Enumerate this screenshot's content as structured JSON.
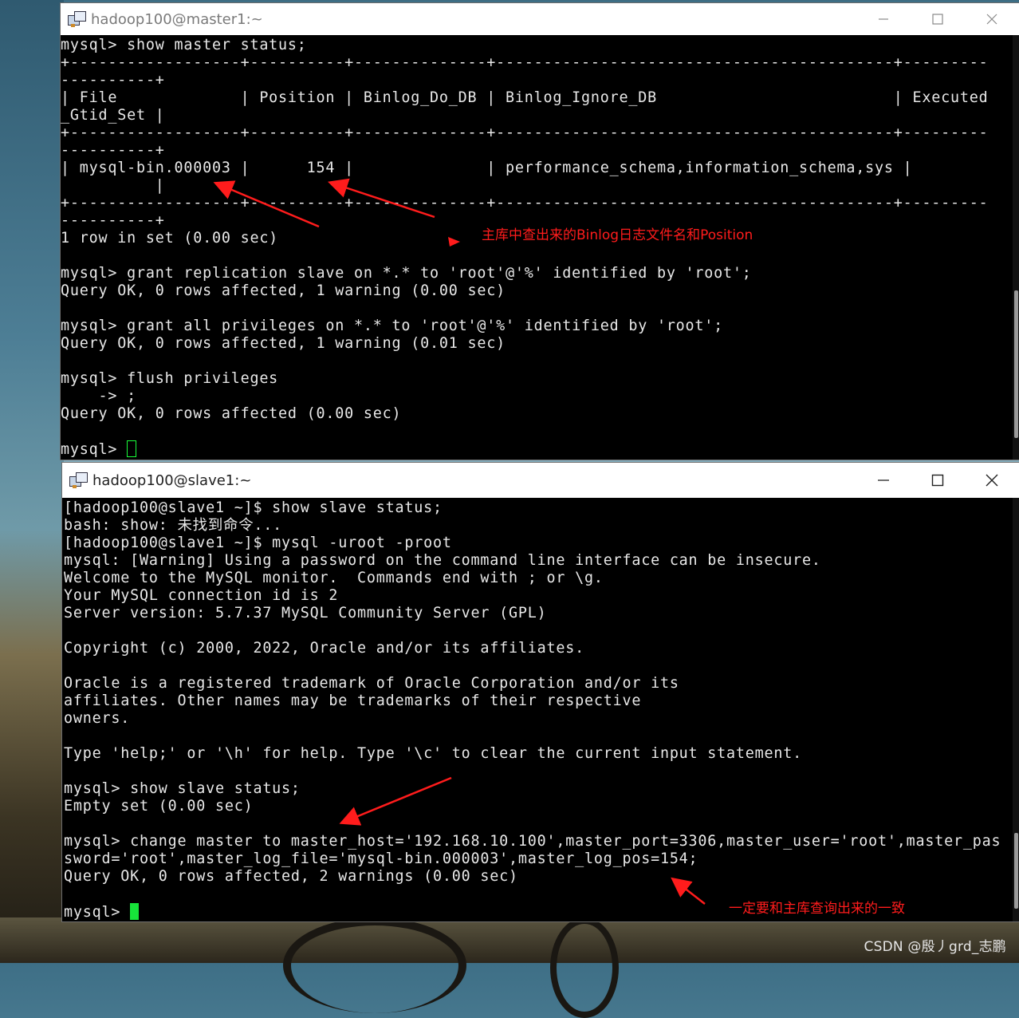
{
  "watermark": "CSDN @殷丿grd_志鹏",
  "master_window": {
    "title": "hadoop100@master1:~",
    "lines": [
      "mysql> show master status;",
      "+------------------+----------+--------------+------------------------------------------+---------",
      "----------+",
      "| File             | Position | Binlog_Do_DB | Binlog_Ignore_DB                         | Executed",
      "_Gtid_Set |",
      "+------------------+----------+--------------+------------------------------------------+---------",
      "----------+",
      "| mysql-bin.000003 |      154 |              | performance_schema,information_schema,sys |",
      "          |",
      "+------------------+----------+--------------+------------------------------------------+---------",
      "----------+",
      "1 row in set (0.00 sec)",
      "",
      "mysql> grant replication slave on *.* to 'root'@'%' identified by 'root';",
      "Query OK, 0 rows affected, 1 warning (0.00 sec)",
      "",
      "mysql> grant all privileges on *.* to 'root'@'%' identified by 'root';",
      "Query OK, 0 rows affected, 1 warning (0.01 sec)",
      "",
      "mysql> flush privileges",
      "    -> ;",
      "Query OK, 0 rows affected (0.00 sec)",
      "",
      "mysql> "
    ]
  },
  "slave_window": {
    "title": "hadoop100@slave1:~",
    "lines": [
      "[hadoop100@slave1 ~]$ show slave status;",
      "bash: show: 未找到命令...",
      "[hadoop100@slave1 ~]$ mysql -uroot -proot",
      "mysql: [Warning] Using a password on the command line interface can be insecure.",
      "Welcome to the MySQL monitor.  Commands end with ; or \\g.",
      "Your MySQL connection id is 2",
      "Server version: 5.7.37 MySQL Community Server (GPL)",
      "",
      "Copyright (c) 2000, 2022, Oracle and/or its affiliates.",
      "",
      "Oracle is a registered trademark of Oracle Corporation and/or its",
      "affiliates. Other names may be trademarks of their respective",
      "owners.",
      "",
      "Type 'help;' or '\\h' for help. Type '\\c' to clear the current input statement.",
      "",
      "mysql> show slave status;",
      "Empty set (0.00 sec)",
      "",
      "mysql> change master to master_host='192.168.10.100',master_port=3306,master_user='root',master_pas",
      "sword='root',master_log_file='mysql-bin.000003',master_log_pos=154;",
      "Query OK, 0 rows affected, 2 warnings (0.00 sec)",
      "",
      "mysql> "
    ]
  },
  "annotations": {
    "binlog_note": "主库中查出来的Binlog日志文件名和Position",
    "consistency_note": "一定要和主库查询出来的一致"
  },
  "colors": {
    "annotation": "#ff1c1c",
    "cursor": "#17e33a",
    "terminal_bg": "#000000",
    "terminal_fg": "#e8e8e8"
  }
}
